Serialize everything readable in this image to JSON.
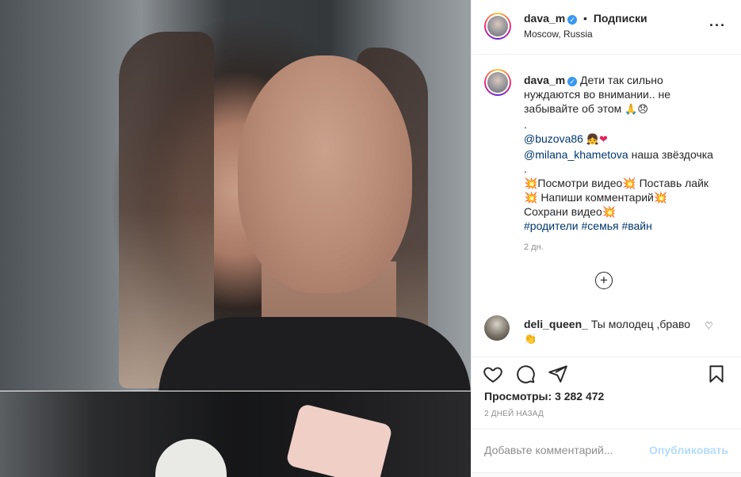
{
  "header": {
    "username": "dava_m",
    "separator": "•",
    "follow_label": "Подписки",
    "location": "Moscow, Russia",
    "more_icon": "···"
  },
  "caption": {
    "username": "dava_m",
    "lines": [
      "Дети так сильно нуждаются во внимании.. не забывайте об этом 🙏😞",
      ".",
      "@buzova86 👧❤️",
      "@milana_khametova наша звёздочка",
      ".",
      "💥Посмотри видео💥 Поставь лайк",
      "💥 Напиши комментарий💥",
      "Сохрани видео💥",
      "#родители #семья #вайн"
    ],
    "line1_text": "Дети так сильно нуждаются во внимании.. не забывайте об этом",
    "line1_emoji": "🙏😞",
    "mention1": "@buzova86",
    "mention1_emoji": "👧❤",
    "mention2": "@milana_khametova",
    "mention2_text": "наша звёздочка",
    "cta1": "💥Посмотри видео💥 Поставь лайк",
    "cta2": "💥 Напиши комментарий💥",
    "cta3": "Сохрани видео💥",
    "hashtags": "#родители #семья #вайн",
    "time_ago": "2 дн."
  },
  "load_more_icon": "+",
  "comments": [
    {
      "username": "deli_queen_",
      "text": "Ты молодец ,браво",
      "emoji": "👏"
    }
  ],
  "actions": {
    "views_label": "Просмотры:",
    "views_count": "3 282 472",
    "date": "2 ДНЕЙ НАЗАД"
  },
  "add_comment": {
    "placeholder": "Добавьте комментарий...",
    "post_label": "Опубликовать"
  },
  "colors": {
    "link": "#00376b",
    "verified": "#3897f0",
    "post_disabled": "#b3dbff",
    "muted": "#8e8e8e",
    "text": "#262626"
  },
  "icons": [
    "heart-icon",
    "comment-icon",
    "share-icon",
    "bookmark-icon",
    "more-icon",
    "plus-circle-icon",
    "verified-badge-icon"
  ]
}
